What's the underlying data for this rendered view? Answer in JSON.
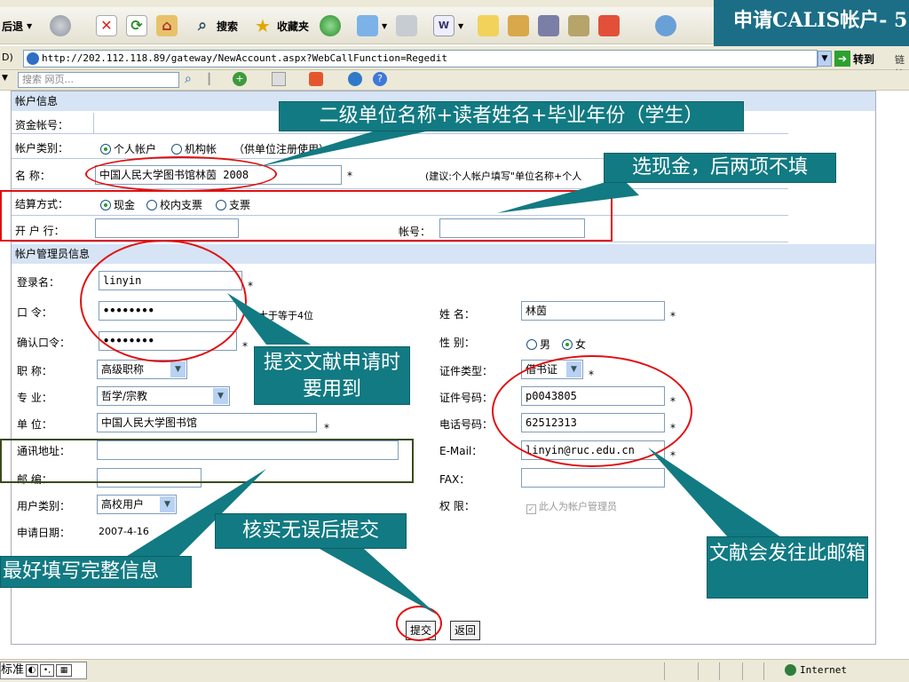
{
  "browser": {
    "toolbar": {
      "back": "后退",
      "search": "搜索",
      "favorites": "收藏夹"
    },
    "address": {
      "url": "http://202.112.118.89/gateway/NewAccount.aspx?WebCallFunction=Regedit",
      "go": "转到",
      "links": "链接"
    },
    "searchbar": {
      "placeholder": "搜索 网页..."
    },
    "status": {
      "ime": "标准",
      "zone": "Internet"
    }
  },
  "slide_title": "申请CALIS帐户- 5",
  "form": {
    "section_account": "帐户信息",
    "fund_account_label": "资金帐号：",
    "account_type_label": "帐户类别：",
    "account_type_options": [
      "个人帐户",
      "机构帐",
      "（供单位注册使用）"
    ],
    "name_label": "名 称：",
    "name_value": "中国人民大学图书馆林茵 2008",
    "name_hint": "(建议:个人帐户填写\"单位名称+个人",
    "settle_label": "结算方式：",
    "settle_options": [
      "现金",
      "校内支票",
      "支票"
    ],
    "bank_label": "开 户 行：",
    "bank_account_label": "帐号：",
    "section_admin": "帐户管理员信息",
    "login_label": "登录名：",
    "login_value": "linyin",
    "password_label": "口 令：",
    "password_value": "••••••••",
    "password_hint": "大于等于4位",
    "confirm_label": "确认口令：",
    "confirm_value": "••••••••",
    "title_label": "职 称：",
    "title_value": "高级职称",
    "major_label": "专 业：",
    "major_value": "哲学/宗教",
    "unit_label": "单 位：",
    "unit_value": "中国人民大学图书馆",
    "address_label": "通讯地址：",
    "zip_label": "邮 编：",
    "user_type_label": "用户类别：",
    "user_type_value": "高校用户",
    "apply_date_label": "申请日期：",
    "apply_date_value": "2007-4-16",
    "realname_label": "姓 名：",
    "realname_value": "林茵",
    "gender_label": "性 别：",
    "gender_options": [
      "男",
      "女"
    ],
    "id_type_label": "证件类型：",
    "id_type_value": "借书证",
    "id_no_label": "证件号码：",
    "id_no_value": "p0043805",
    "phone_label": "电话号码：",
    "phone_value": "62512313",
    "email_label": "E-Mail：",
    "email_value": "linyin@ruc.edu.cn",
    "fax_label": "FAX：",
    "rights_label": "权 限：",
    "rights_value": "此人为帐户管理员",
    "required_mark": "*",
    "submit": "提交",
    "back": "返回"
  },
  "callouts": {
    "name_format": "二级单位名称+读者姓名+毕业年份（学生）",
    "cash": "选现金，后两项不填",
    "needed": "提交文献申请时要用到",
    "complete": "最好填写完整信息",
    "verify": "核实无误后提交",
    "email": "文献会发往此邮箱"
  }
}
